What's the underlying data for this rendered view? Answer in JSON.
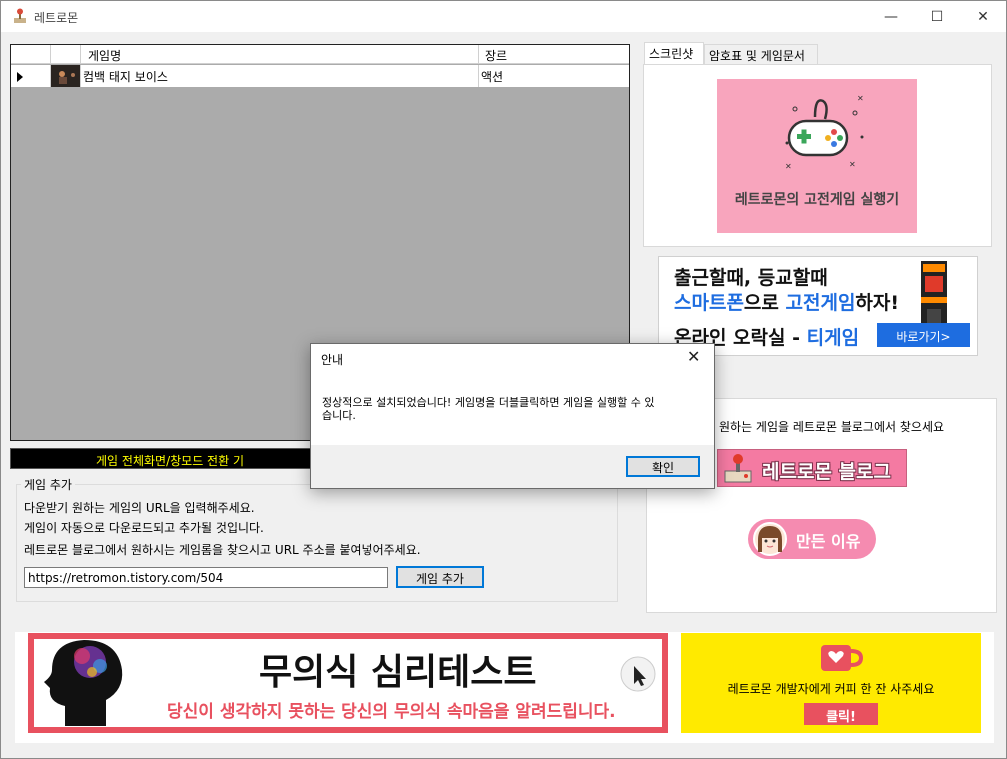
{
  "window": {
    "title": "레트로몬",
    "minimize": "—",
    "maximize": "☐",
    "close": "✕"
  },
  "grid": {
    "columns": [
      "게임명",
      "장르"
    ],
    "rows": [
      {
        "name": "컴백 태지 보이스",
        "genre": "액션"
      }
    ]
  },
  "fullscreen_hint": "게임 전체화면/창모드 전환 기",
  "add_game": {
    "group_title": "게임 추가",
    "lines": [
      "다운받기 원하는 게임의 URL을 입력해주세요.",
      "게임이 자동으로 다운로드되고 추가될 것입니다.",
      "레트로몬 블로그에서 원하시는 게임롬을 찾으시고 URL 주소를 붙여넣어주세요."
    ],
    "url_value": "https://retromon.tistory.com/504",
    "button_label": "게임 추가"
  },
  "tabs": [
    {
      "label": "스크린샷",
      "active": true
    },
    {
      "label": "암호표 및 게임문서",
      "active": false
    }
  ],
  "screenshot": {
    "caption": "레트로몬의 고전게임 실행기"
  },
  "ad": {
    "line1": "출근할때, 등교할때",
    "line2_a": "스마트폰",
    "line2_b": "으로 ",
    "line2_c": "고전게임",
    "line2_d": "하자!",
    "line3_a": "온라인 오락실 - ",
    "line3_b": "티게임",
    "button": "바로가기>"
  },
  "side": {
    "find_text": "원하는 게임을 레트로몬 블로그에서 찾으세요",
    "blog_button": "레트로몬 블로그",
    "why_button": "만든 이유"
  },
  "banner": {
    "title": "무의식 심리테스트",
    "subtitle": "당신이 생각하지 못하는 당신의 무의식 속마음을 알려드립니다."
  },
  "coffee": {
    "text": "레트로몬 개발자에게 커피 한 잔 사주세요",
    "button": "클릭!"
  },
  "dialog": {
    "title": "안내",
    "message_line1": "정상적으로 설치되었습니다! 게임명을 더블클릭하면 게임을 실행할 수 있",
    "message_line2": "습니다.",
    "ok": "확인",
    "close": "✕"
  },
  "colors": {
    "accent": "#0078d7",
    "pink": "#f8a5bd",
    "red": "#e8515f",
    "yellow": "#ffea00",
    "blue": "#1e6de0"
  }
}
